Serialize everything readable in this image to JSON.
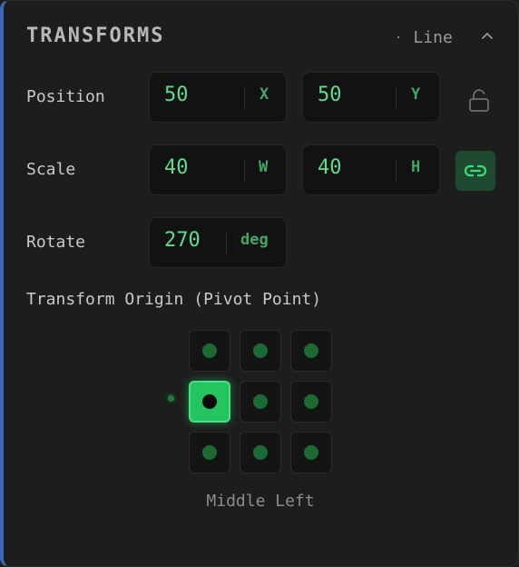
{
  "header": {
    "title": "TRANSFORMS",
    "subtitle": "Line",
    "dot": "·"
  },
  "position": {
    "label": "Position",
    "x": {
      "value": "50",
      "unit": "X"
    },
    "y": {
      "value": "50",
      "unit": "Y"
    },
    "lock_icon": "unlocked-padlock-icon"
  },
  "scale": {
    "label": "Scale",
    "w": {
      "value": "40",
      "unit": "W"
    },
    "h": {
      "value": "40",
      "unit": "H"
    },
    "link_icon": "link-icon",
    "linked": true
  },
  "rotate": {
    "label": "Rotate",
    "value": "270",
    "unit": "deg"
  },
  "origin": {
    "label": "Transform Origin (Pivot Point)",
    "selected": "Middle Left",
    "points": [
      "Top Left",
      "Top Center",
      "Top Right",
      "Middle Left",
      "Middle Center",
      "Middle Right",
      "Bottom Left",
      "Bottom Center",
      "Bottom Right"
    ]
  },
  "colors": {
    "accent": "#22c55e",
    "value_text": "#5fdc8e",
    "panel_edge": "#3f67b5"
  }
}
